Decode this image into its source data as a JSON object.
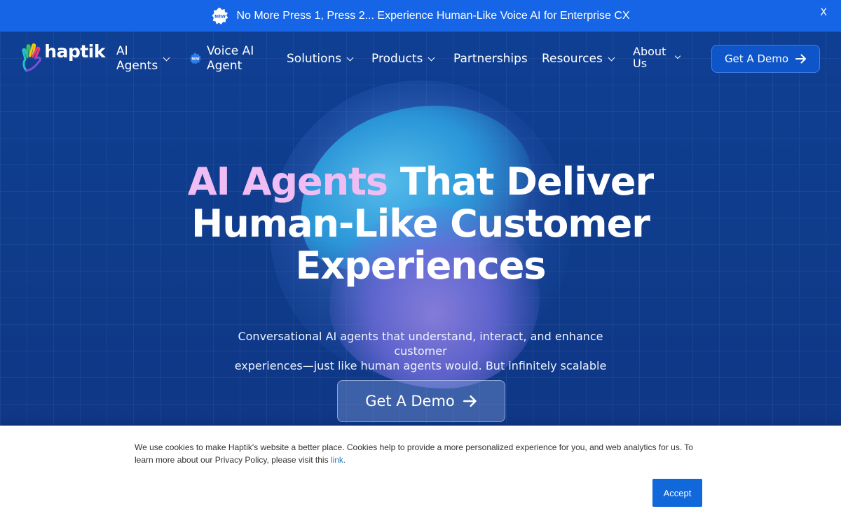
{
  "announcement": {
    "badge": "NEW",
    "text": "No More Press 1, Press 2... Experience Human-Like Voice AI for Enterprise CX",
    "close_label": "X"
  },
  "nav": {
    "logo_text": "haptik",
    "items": [
      {
        "label_line1": "AI",
        "label_line2": "Agents"
      },
      {
        "label_line1": "Voice AI",
        "label_line2": "Agent",
        "badge": "NEW"
      },
      {
        "label": "Solutions"
      },
      {
        "label": "Products"
      },
      {
        "label": "Partnerships"
      },
      {
        "label": "Resources"
      },
      {
        "label_line1": "About",
        "label_line2": "Us"
      }
    ],
    "cta_label": "Get A Demo"
  },
  "hero": {
    "title_accent": "AI Agents",
    "title_rest_1": " That Deliver",
    "title_line2": "Human-Like Customer",
    "title_line3": "Experiences",
    "subtitle_line1": "Conversational AI agents that understand, interact, and enhance customer",
    "subtitle_line2": "experiences—just like human agents would. But infinitely scalable",
    "cta_label": "Get A Demo"
  },
  "cookie": {
    "text": "We use cookies to make Haptik's website a better place. Cookies help to provide a more personalized experience for you, and web analytics for us. To learn more about our Privacy Policy, please visit this ",
    "link_text": "link.",
    "accept_label": "Accept"
  },
  "colors": {
    "announce_bg": "#1565e6",
    "hero_bg": "#0f3b8a",
    "accent_text": "#efbdf3",
    "cookie_button": "#1068db"
  }
}
